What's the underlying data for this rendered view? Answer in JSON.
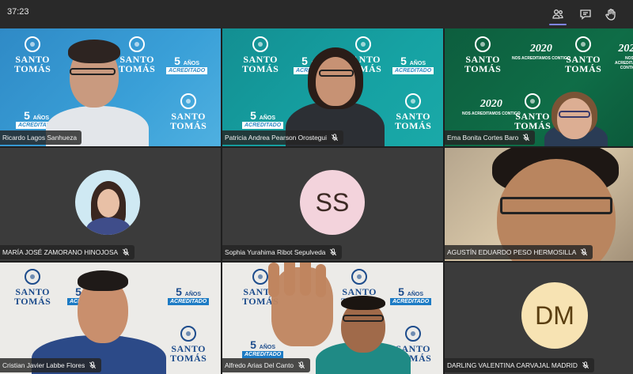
{
  "header": {
    "timer": "37:23",
    "buttons": {
      "people": "people-icon",
      "chat": "chat-icon",
      "raise_hand": "raise-hand-icon"
    }
  },
  "branding": {
    "santo": "SANTO",
    "tomas": "TOMÁS",
    "years": "5",
    "years_suffix": "AÑOS",
    "accredited": "ACREDITADO",
    "campaign_number": "2020",
    "campaign_line": "NOS ACREDITAMOS CONTIGO"
  },
  "participants": [
    {
      "name": "Ricardo Lagos Sanhueza",
      "muted": false,
      "kind": "video"
    },
    {
      "name": "Patricia Andrea Pearson Orostegui",
      "muted": true,
      "kind": "video"
    },
    {
      "name": "Ema Bonita Cortes Baro",
      "muted": true,
      "kind": "video"
    },
    {
      "name": "MARÍA JOSÉ ZAMORANO HINOJOSA",
      "muted": true,
      "kind": "photo"
    },
    {
      "name": "Sophia Yurahima Ribot Sepulveda",
      "muted": true,
      "kind": "initials",
      "initials": "SS"
    },
    {
      "name": "AGUSTÍN EDUARDO PESO HERMOSILLA",
      "muted": true,
      "kind": "video"
    },
    {
      "name": "Cristian Javier Labbe Flores",
      "muted": true,
      "kind": "video"
    },
    {
      "name": "Alfredo Arias Del Canto",
      "muted": true,
      "kind": "video"
    },
    {
      "name": "DARLING VALENTINA CARVAJAL MADRID",
      "muted": true,
      "kind": "initials",
      "initials": "DM"
    }
  ],
  "colors": {
    "topbar": "#292929",
    "tile_empty": "#3b3b3b",
    "accent": "#7f85f5",
    "avatar_ss": "#f3d3dc",
    "avatar_dm": "#f7e3b3"
  }
}
